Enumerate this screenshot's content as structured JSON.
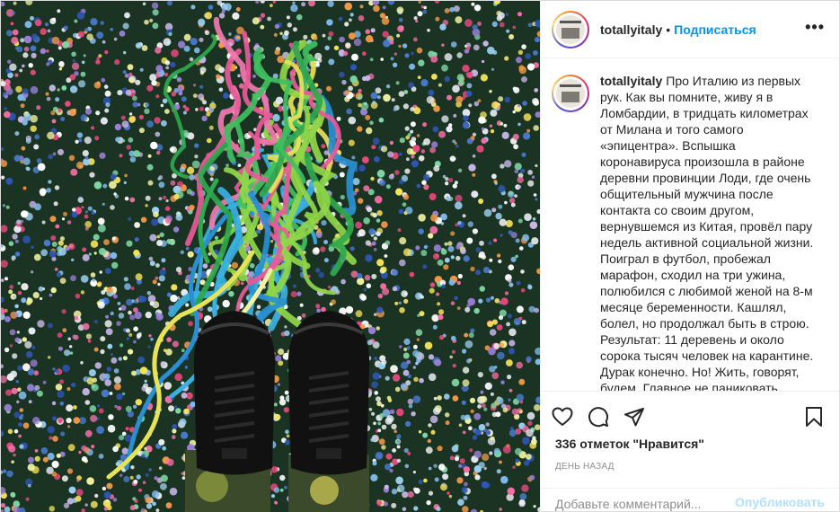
{
  "header": {
    "username": "totallyitaly",
    "separator": "•",
    "follow_label": "Подписаться",
    "more_icon": "more-options-icon"
  },
  "caption": {
    "username": "totallyitaly",
    "text": "Про Италию из первых рук. Как вы помните, живу я в Ломбардии, в тридцать километрах от Милана и того самого «эпицентра». Вспышка коронавируса произошла в районе деревни провинции Лоди, где очень общительный мужчина после контакта со своим другом, вернувшемся из Китая, провёл пару недель активной социальной жизни. Поиграл в футбол, пробежал марафон, сходил на три ужина, полюбился с любимой женой на 8-м месяце беременности. Кашлял, болел, но продолжал быть в строю. Результат: 11 деревень и около сорока тысяч человек на карантине. Дурак конечно. Но! Жить, говорят, будем. Главное не паниковать."
  },
  "actions": {
    "icons": [
      "heart-icon",
      "comment-icon",
      "share-icon",
      "bookmark-icon"
    ],
    "likes": "336 отметок \"Нравится\"",
    "date": "ДЕНЬ НАЗАД"
  },
  "add_comment": {
    "placeholder": "Добавьте комментарий...",
    "publish_label": "Опубликовать"
  },
  "colors": {
    "link": "#0095f6",
    "publish_disabled": "#b2dffc",
    "muted": "#8e8e8e",
    "border": "#efefef"
  }
}
